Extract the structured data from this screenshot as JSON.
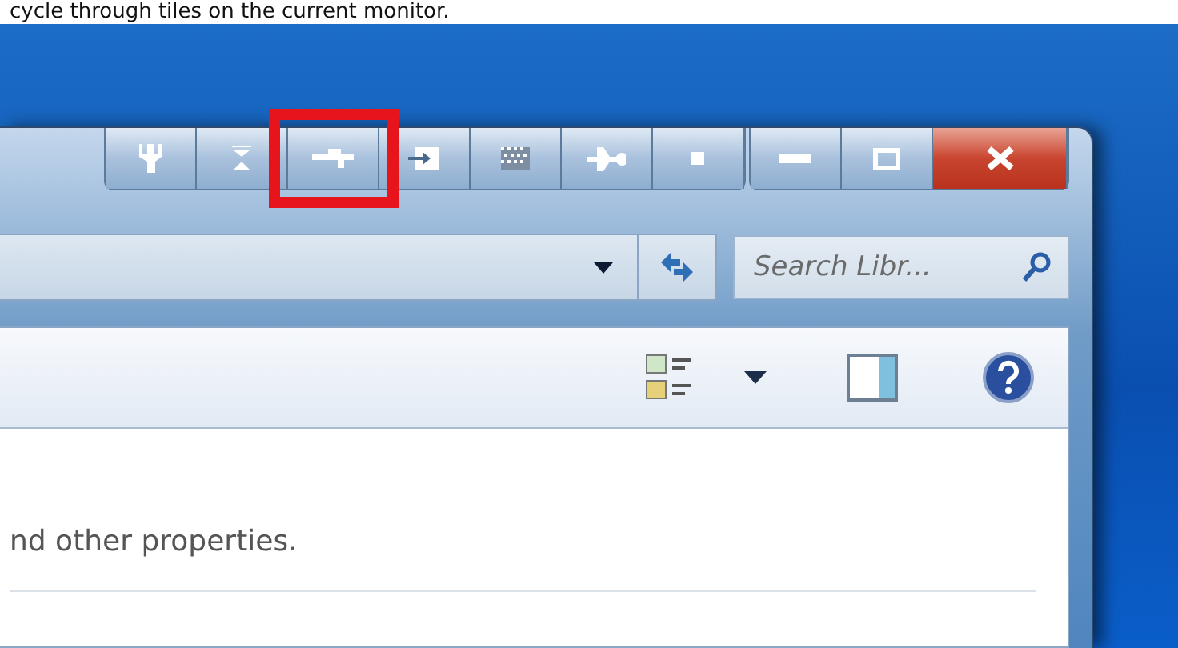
{
  "caption": "cycle through tiles on the current monitor.",
  "title_buttons": [
    {
      "kind": "wrench",
      "highlighted": false
    },
    {
      "kind": "collapse",
      "highlighted": false
    },
    {
      "kind": "tile",
      "highlighted": true
    },
    {
      "kind": "enter",
      "highlighted": false
    },
    {
      "kind": "checker",
      "highlighted": false
    },
    {
      "kind": "pin",
      "highlighted": false
    },
    {
      "kind": "dot",
      "highlighted": false
    }
  ],
  "window_buttons": [
    {
      "kind": "minimize"
    },
    {
      "kind": "maximize"
    },
    {
      "kind": "close"
    }
  ],
  "search": {
    "placeholder": "Search Libr..."
  },
  "content_text": "nd other properties."
}
